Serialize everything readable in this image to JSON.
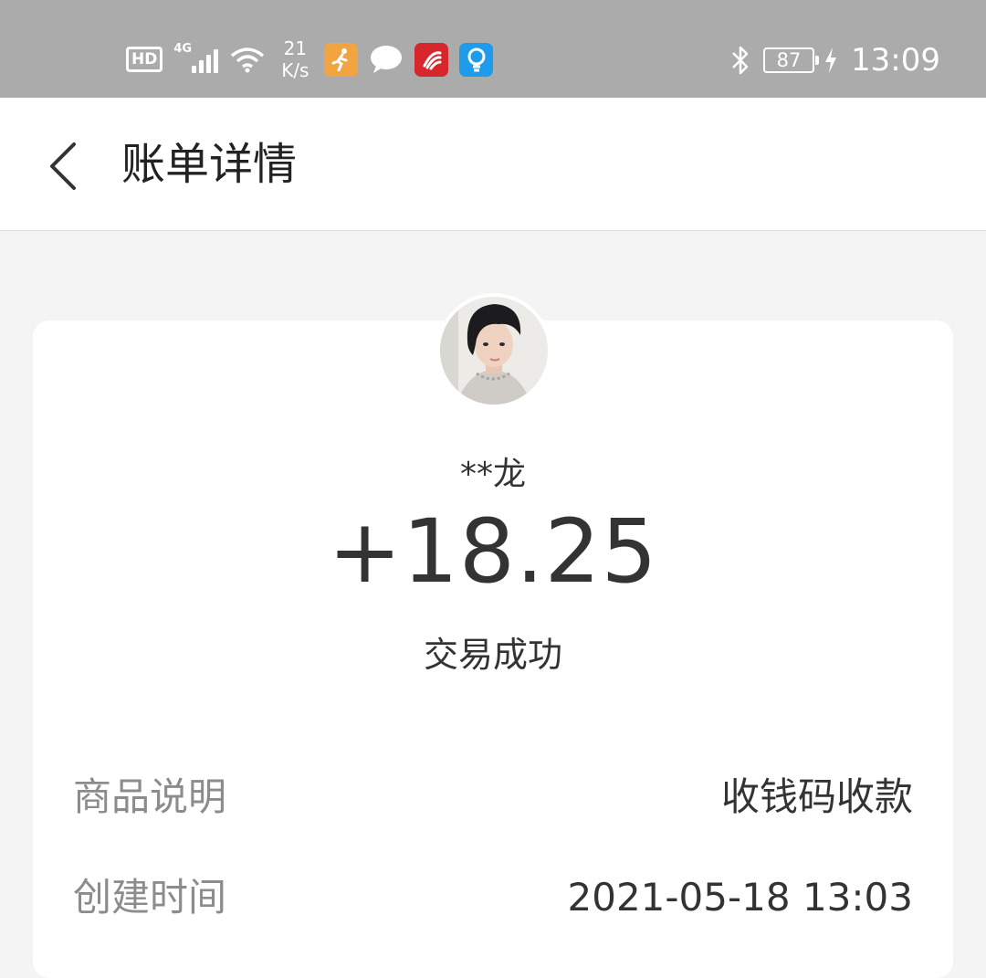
{
  "status_bar": {
    "hd": "HD",
    "network": "4G",
    "speed_value": "21",
    "speed_unit": "K/s",
    "battery": "87",
    "time": "13:09",
    "icons": [
      "hd-icon",
      "signal-icon",
      "wifi-icon",
      "fitness-app-icon",
      "message-app-icon",
      "red-app-icon",
      "lightbulb-app-icon",
      "bluetooth-icon",
      "battery-icon",
      "charging-icon"
    ],
    "colors": {
      "background": "#ababab",
      "fitness": "#f0a442",
      "red_app": "#d7262c",
      "blue_app": "#1e9bea"
    }
  },
  "nav": {
    "title": "账单详情",
    "back_icon": "chevron-left-icon"
  },
  "detail": {
    "name": "**龙",
    "amount": "+18.25",
    "status": "交易成功",
    "rows": [
      {
        "label": "商品说明",
        "value": "收钱码收款"
      },
      {
        "label": "创建时间",
        "value": "2021-05-18 13:03"
      }
    ]
  }
}
